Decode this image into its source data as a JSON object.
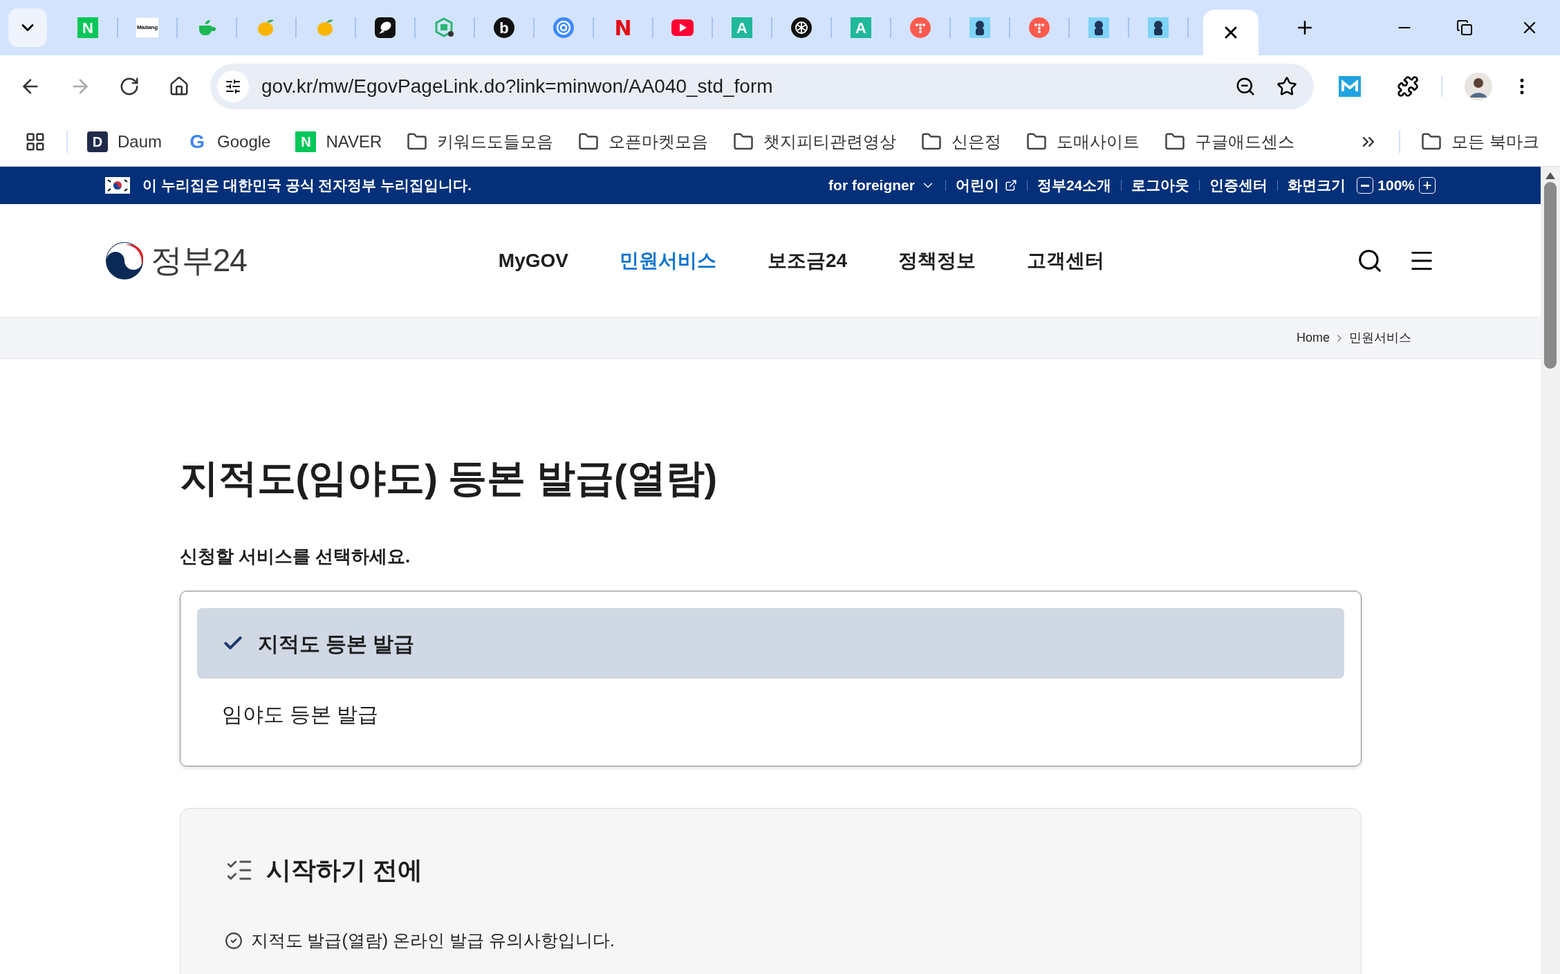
{
  "browser": {
    "tabs": [
      {
        "kind": "letter",
        "glyph": "N",
        "color": "#03c75a"
      },
      {
        "kind": "wordmark",
        "glyph": "Madang",
        "color": "#ffffff"
      },
      {
        "kind": "cup",
        "color": "#1db954"
      },
      {
        "kind": "mango",
        "color": "#f7b500"
      },
      {
        "kind": "mango",
        "color": "#f7b500"
      },
      {
        "kind": "bubble",
        "color": "#111111"
      },
      {
        "kind": "hex",
        "color": "#2bb673"
      },
      {
        "kind": "round-letter",
        "glyph": "b",
        "color": "#111111"
      },
      {
        "kind": "ring",
        "color": "#3d8bfd"
      },
      {
        "kind": "plain-letter",
        "glyph": "N",
        "color": "#e50914"
      },
      {
        "kind": "play",
        "color": "#ff0033"
      },
      {
        "kind": "letter",
        "glyph": "A",
        "color": "#1fb89a"
      },
      {
        "kind": "knot",
        "color": "#111111"
      },
      {
        "kind": "letter",
        "glyph": "A",
        "color": "#1fb89a"
      },
      {
        "kind": "dots",
        "color": "#ff5a4e"
      },
      {
        "kind": "figure",
        "color": "#7fd3f7"
      },
      {
        "kind": "dots",
        "color": "#ff5a4e"
      },
      {
        "kind": "figure",
        "color": "#7fd3f7"
      },
      {
        "kind": "figure",
        "color": "#7fd3f7"
      }
    ],
    "address": {
      "url": "gov.kr/mw/EgovPageLink.do?link=minwon/AA040_std_form"
    },
    "bookmarks": [
      {
        "kind": "daum",
        "glyph": "D",
        "label": "Daum"
      },
      {
        "kind": "google",
        "glyph": "G",
        "label": "Google"
      },
      {
        "kind": "naver",
        "glyph": "N",
        "label": "NAVER"
      },
      {
        "kind": "folder",
        "label": "키워드도들모음"
      },
      {
        "kind": "folder",
        "label": "오픈마켓모음"
      },
      {
        "kind": "folder",
        "label": "챗지피티관련영상"
      },
      {
        "kind": "folder",
        "label": "신은정"
      },
      {
        "kind": "folder",
        "label": "도매사이트"
      },
      {
        "kind": "folder",
        "label": "구글애드센스"
      }
    ],
    "all_bookmarks": "모든 북마크"
  },
  "banner": {
    "text": "이 누리집은 대한민국 공식 전자정부 누리집입니다.",
    "links": [
      {
        "kind": "dropdown",
        "label": "for foreigner"
      },
      {
        "kind": "external",
        "label": "어린이"
      },
      {
        "kind": "plain",
        "label": "정부24소개"
      },
      {
        "kind": "plain",
        "label": "로그아웃"
      },
      {
        "kind": "plain",
        "label": "인증센터"
      }
    ],
    "zoom": {
      "label": "화면크기",
      "value": "100%"
    }
  },
  "header": {
    "logo": "정부24",
    "nav": [
      {
        "label": "MyGOV",
        "selected": false
      },
      {
        "label": "민원서비스",
        "selected": true
      },
      {
        "label": "보조금24",
        "selected": false
      },
      {
        "label": "정책정보",
        "selected": false
      },
      {
        "label": "고객센터",
        "selected": false
      }
    ]
  },
  "breadcrumb": [
    "Home",
    "민원서비스"
  ],
  "page": {
    "title": "지적도(임야도) 등본 발급(열람)",
    "prompt": "신청할 서비스를 선택하세요.",
    "options": [
      {
        "label": "지적도 등본 발급",
        "selected": true
      },
      {
        "label": "임야도 등본 발급",
        "selected": false
      }
    ],
    "notice": {
      "title": "시작하기 전에",
      "items": [
        "지적도 발급(열람) 온라인 발급 유의사항입니다."
      ]
    }
  }
}
